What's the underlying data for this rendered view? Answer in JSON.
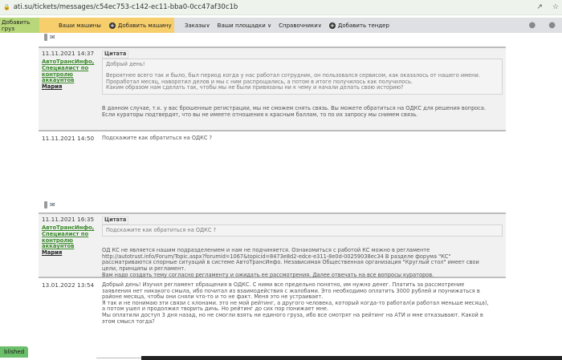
{
  "browser": {
    "url": "ati.su/tickets/messages/c54ec753-c142-ec11-bba0-0cc47af30c1b"
  },
  "nav": {
    "add_cargo": "Добавить груз",
    "your_trucks": "Ваши машины",
    "add_truck": "Добавить машину",
    "orders": "Заказы",
    "platforms": "Ваши площадки",
    "references": "Справочники",
    "add_tender": "Добавить тендер"
  },
  "messages": [
    {
      "date": "11.11.2021 14:37",
      "author_org": "АвтоТрансИнфо, Специалист по контролю аккаунтов",
      "author_name": "Мария",
      "quote_label": "Цитата",
      "quote_lines": [
        "Добрый день!",
        "",
        "Вероятнее всего так и было, был период когда у нас работал сотрудник, он пользовался сервисом, как оказалось от нашего имени.",
        "Проработал месяц, наворотил делов и мы с ним распрощались, а потом в итоге получилось как получилось.",
        "Каким образом нам сделать так, чтобы мы не были привязаны ни к чему и начали делать свою историю?"
      ],
      "text_lines": [
        "В данном случае, т.к. у вас брошенные регистрации, мы не сможем снять связь. Вы можете обратиться на ОДКС для решения вопроса.",
        "Если кураторы подтвердят, что вы не имеете отношения к красным баллам, то по их запросу мы снимем связь."
      ]
    },
    {
      "date": "11.11.2021 14:50",
      "text_lines": [
        "Подскажите как обратиться на ОДКС ?"
      ]
    },
    {
      "date": "11.11.2021 16:35",
      "author_org": "АвтоТрансИнфо, Специалист по контролю аккаунтов",
      "author_name": "Мария",
      "quote_label": "Цитата",
      "quote_lines": [
        "Подскажите как обратиться на ОДКС ?"
      ],
      "text_lines": [
        "ОД КС не является нашим подразделением и нам не подчиняется. Ознакомиться с работой КС можно в регламенте",
        "http://autotrust.info/Forum/Topic.aspx?forumid=1067&topicid=8473e8d2-edce-e311-8e0d-00259038ec34 В разделе форума \"КС\"",
        "рассматриваются спорные ситуаций в системе АвтоТрансИнфо. Независимая Общественная организация \"Круглый стол\" имеет свои",
        "цели, принципы и регламент.",
        "Вам надо создать тему согласно регламенту и ожидать ее рассмотрения. Далее отвечать на все вопросы кураторов."
      ]
    },
    {
      "date": "13.01.2022 13:54",
      "text_lines": [
        "Добрый день! Изучил регламент обращения в ОДКС. С ними все предельно понятно, им нужно денег. Платить за рассмотрение",
        "заявления нет никакого смыла, ибо почитал из взаимодействия с жалобами. Это необходимо оплатить 3000 рублей и поунижаться в",
        "районе месяца, чтобы они сняли что-то и то не факт. Меня это не устраивает.",
        "Я так и не понимаю эти связи с клонами. это не мой рейтинг, а другого человека, который когда-то работал(и работал меньше месяца),",
        "а потом ушел и продолжил творить дичь. Но рейтинг до сих пор понижает мне.",
        "Мы оплатили доступ 3 дня назад, но не смогли взять ни единого груза, ибо все смотрят на рейтинг на АТИ и мне отказывают. Какой в",
        "этом смысл тогда?"
      ]
    }
  ],
  "status_badge": "blished"
}
